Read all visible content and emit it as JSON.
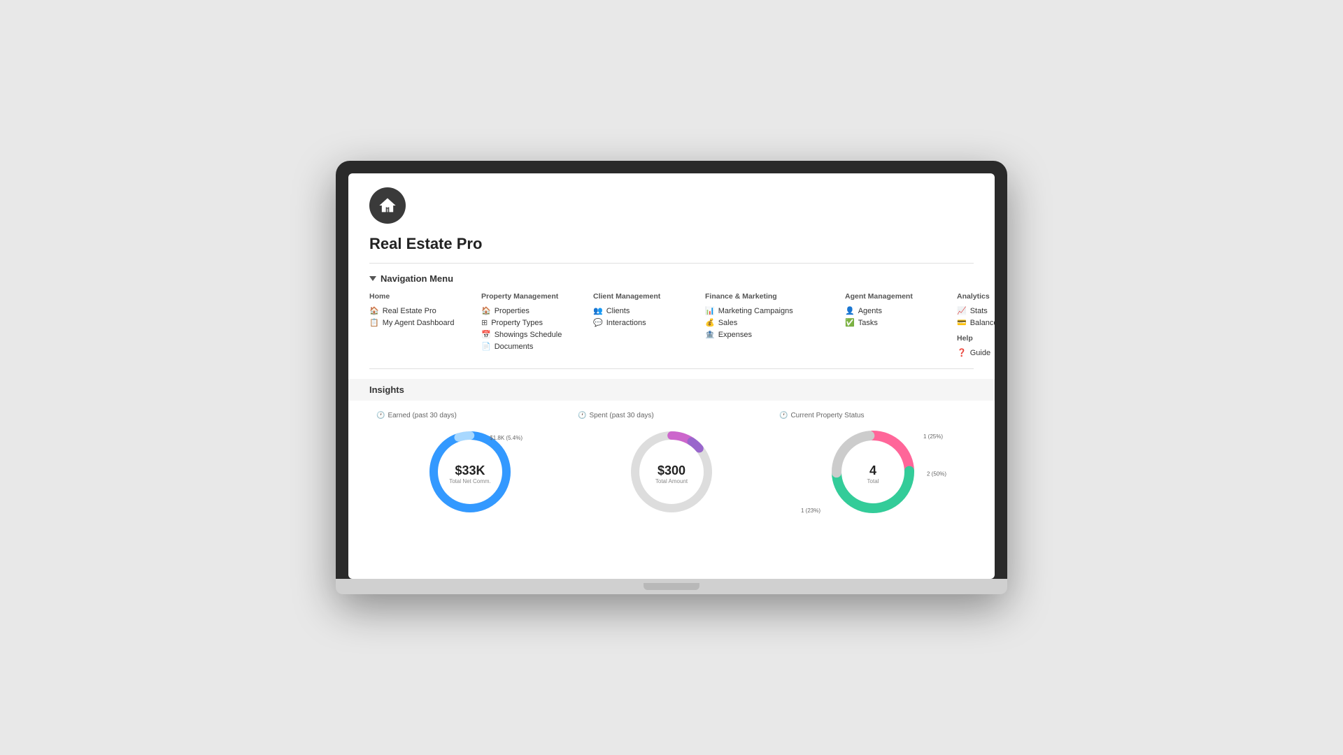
{
  "app": {
    "title": "Real Estate Pro"
  },
  "nav": {
    "section_label": "Navigation Menu",
    "columns": [
      {
        "title": "Home",
        "items": [
          {
            "icon": "🏠",
            "label": "Real Estate Pro"
          },
          {
            "icon": "📋",
            "label": "My Agent Dashboard"
          }
        ]
      },
      {
        "title": "Property Management",
        "items": [
          {
            "icon": "🏠",
            "label": "Properties"
          },
          {
            "icon": "⊞",
            "label": "Property Types"
          },
          {
            "icon": "📅",
            "label": "Showings Schedule"
          },
          {
            "icon": "📄",
            "label": "Documents"
          }
        ]
      },
      {
        "title": "Client Management",
        "items": [
          {
            "icon": "👥",
            "label": "Clients"
          },
          {
            "icon": "💬",
            "label": "Interactions"
          }
        ]
      },
      {
        "title": "Finance & Marketing",
        "items": [
          {
            "icon": "📊",
            "label": "Marketing Campaigns"
          },
          {
            "icon": "💰",
            "label": "Sales"
          },
          {
            "icon": "🏦",
            "label": "Expenses"
          }
        ]
      },
      {
        "title": "Agent Management",
        "items": [
          {
            "icon": "👤",
            "label": "Agents"
          },
          {
            "icon": "✅",
            "label": "Tasks"
          }
        ]
      },
      {
        "title": "Analytics",
        "items": [
          {
            "icon": "📈",
            "label": "Stats"
          },
          {
            "icon": "💳",
            "label": "Balance"
          }
        ],
        "extra_title": "Help",
        "extra_items": [
          {
            "icon": "❓",
            "label": "Guide"
          }
        ]
      }
    ]
  },
  "insights": {
    "title": "Insights",
    "charts": [
      {
        "label": "Earned (past 30 days)",
        "value": "$33K",
        "sublabel": "Total Net Comm.",
        "annotation": "$1.8K (5.4%)",
        "annotation_position": "top-right",
        "type": "donut",
        "color_main": "#3399ff",
        "color_secondary": "#a0d0ff"
      },
      {
        "label": "Spent (past 30 days)",
        "value": "$300",
        "sublabel": "Total Amount",
        "type": "donut",
        "color_main": "#cc66cc",
        "color_secondary": "#dddddd"
      },
      {
        "label": "Current Property Status",
        "value": "4",
        "sublabel": "Total",
        "type": "donut_multi",
        "segments": [
          {
            "color": "#ff6699",
            "label": "1 (25%)",
            "position": "top-right"
          },
          {
            "color": "#33cc99",
            "label": "2 (50%)",
            "position": "right"
          },
          {
            "color": "#dddddd",
            "label": "1 (23%)",
            "position": "bottom-left"
          }
        ]
      }
    ]
  }
}
